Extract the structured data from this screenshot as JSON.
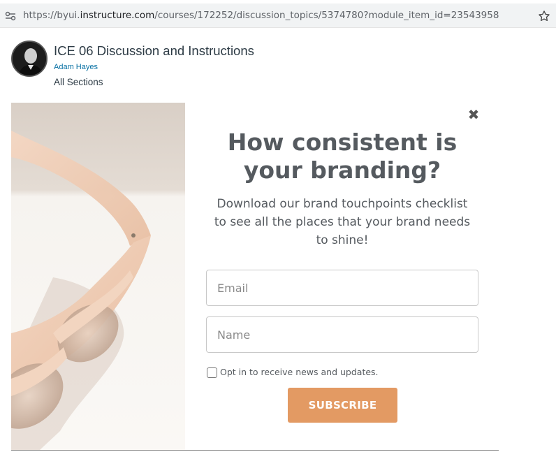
{
  "browser": {
    "url_prefix": "https://byui.",
    "url_host": "instructure.com",
    "url_path": "/courses/172252/discussion_topics/5374780?module_item_id=23543958",
    "site_info_icon": "tune-icon",
    "bookmark_icon": "star-icon"
  },
  "discussion": {
    "title": "ICE 06 Discussion and Instructions",
    "author": "Adam Hayes",
    "sections": "All Sections"
  },
  "popup": {
    "close_label": "✖",
    "headline_line1": "How consistent is",
    "headline_line2": "your branding?",
    "subtext_line1": "Download our brand touchpoints checklist",
    "subtext_line2": "to see all the places that your brand needs",
    "subtext_line3": "to shine!",
    "email_placeholder": "Email",
    "name_placeholder": "Name",
    "optin_label": "Opt in to receive news and updates.",
    "subscribe_label": "SUBSCRIBE",
    "colors": {
      "accent": "#e39a63",
      "heading": "#555a5f",
      "link": "#0770a3"
    }
  }
}
